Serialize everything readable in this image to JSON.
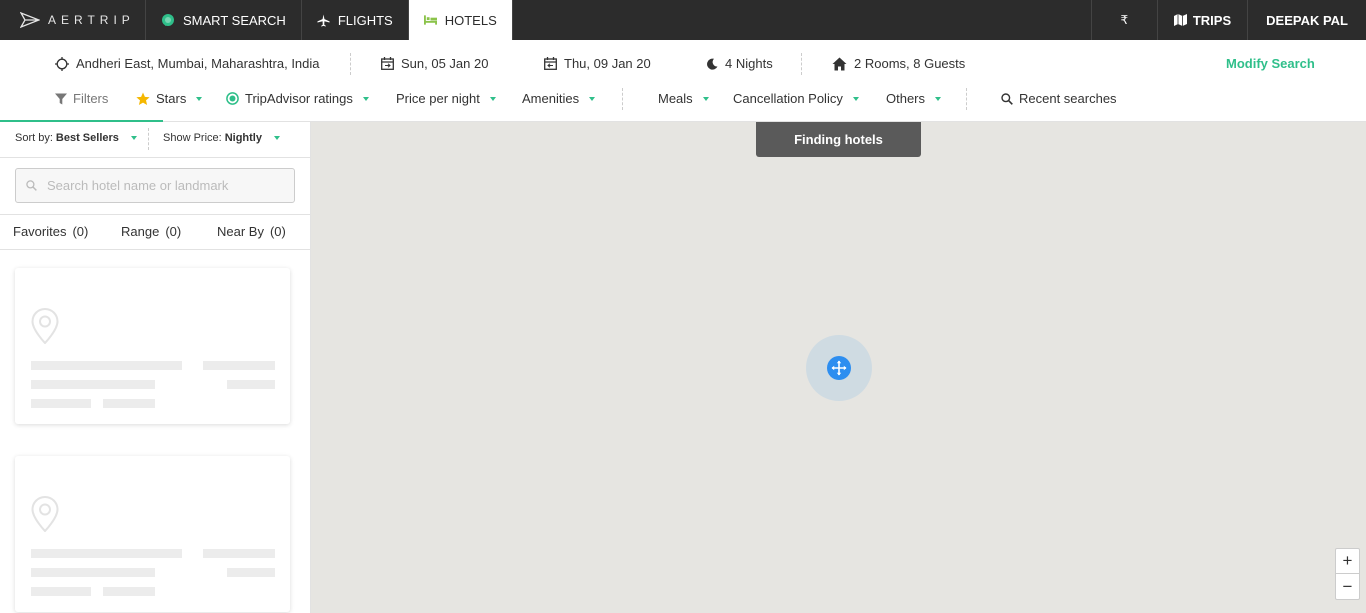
{
  "topnav": {
    "logo_text": "AERTRIP",
    "items": [
      {
        "label": "SMART SEARCH"
      },
      {
        "label": "FLIGHTS"
      },
      {
        "label": "HOTELS"
      }
    ],
    "currency": "₹",
    "trips": "TRIPS",
    "user": "DEEPAK PAL"
  },
  "search": {
    "location": "Andheri East, Mumbai, Maharashtra, India",
    "checkin": "Sun, 05 Jan 20",
    "checkout": "Thu, 09 Jan 20",
    "nights": "4 Nights",
    "rooms_guests": "2 Rooms, 8 Guests",
    "modify": "Modify Search"
  },
  "filters": {
    "filters": "Filters",
    "stars": "Stars",
    "tripadvisor": "TripAdvisor ratings",
    "price": "Price per night",
    "amenities": "Amenities",
    "meals": "Meals",
    "cancellation": "Cancellation Policy",
    "others": "Others",
    "recent": "Recent searches"
  },
  "sidebar": {
    "sort_label": "Sort by:",
    "sort_value": "Best Sellers",
    "price_label": "Show Price:",
    "price_value": "Nightly",
    "search_placeholder": "Search hotel name or landmark",
    "tabs": [
      {
        "label": "Favorites",
        "count": "(0)"
      },
      {
        "label": "Range",
        "count": "(0)"
      },
      {
        "label": "Near By",
        "count": "(0)"
      }
    ]
  },
  "map": {
    "status": "Finding hotels",
    "zoom_in": "+",
    "zoom_out": "−"
  },
  "colors": {
    "accent": "#2fbf8a",
    "topbar": "#2c2c2c",
    "map_bg": "#e6e5e1",
    "marker": "#2d8ef0"
  }
}
